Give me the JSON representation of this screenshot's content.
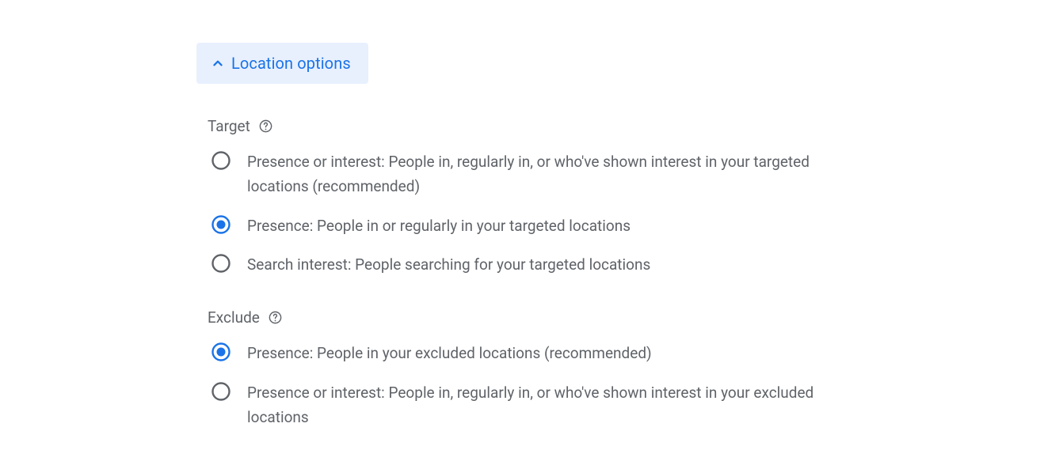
{
  "colors": {
    "accent": "#1a73e8",
    "accent_bg": "#e8f0fe",
    "text_muted": "#5f6368",
    "radio_unselected": "#5f6368",
    "radio_selected": "#1a73e8"
  },
  "expander": {
    "label": "Location options",
    "expanded": true
  },
  "sections": {
    "target": {
      "title": "Target",
      "options": [
        {
          "label": "Presence or interest: People in, regularly in, or who've shown interest in your targeted locations (recommended)",
          "selected": false
        },
        {
          "label": "Presence: People in or regularly in your targeted locations",
          "selected": true
        },
        {
          "label": "Search interest: People searching for your targeted locations",
          "selected": false
        }
      ]
    },
    "exclude": {
      "title": "Exclude",
      "options": [
        {
          "label": "Presence: People in your excluded locations (recommended)",
          "selected": true
        },
        {
          "label": "Presence or interest: People in, regularly in, or who've shown interest in your excluded locations",
          "selected": false
        }
      ]
    }
  }
}
